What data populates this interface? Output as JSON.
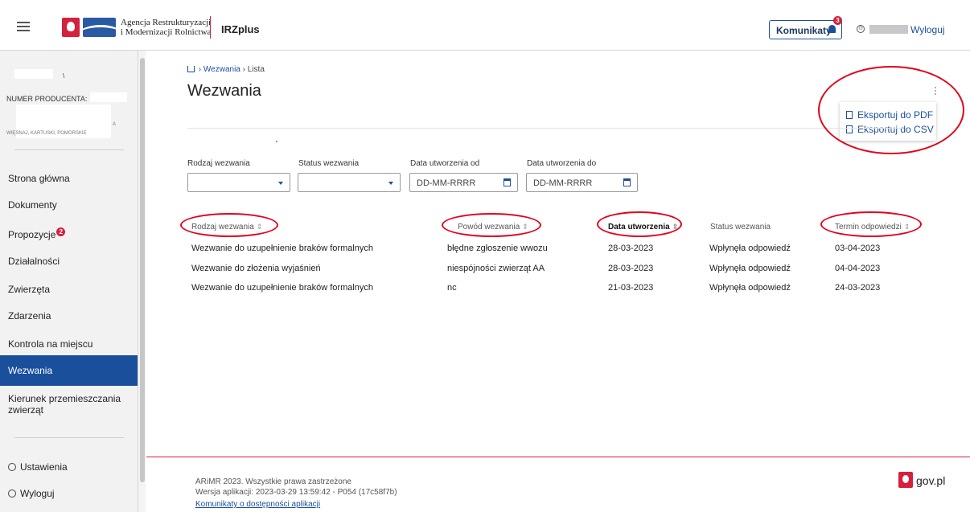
{
  "header": {
    "org_line1": "Agencja Restrukturyzacji",
    "org_line2": "i Modernizacji Rolnictwa",
    "brand": "IRZplus",
    "komunikaty_label": "Komunikaty",
    "notification_count": "3",
    "logout_label": "Wyloguj"
  },
  "sidebar": {
    "producer_label": "NUMER PRODUCENTA:",
    "items": [
      {
        "label": "Strona główna"
      },
      {
        "label": "Dokumenty"
      },
      {
        "label": "Propozycje",
        "badge": "2"
      },
      {
        "label": "Działalności"
      },
      {
        "label": "Zwierzęta"
      },
      {
        "label": "Zdarzenia"
      },
      {
        "label": "Kontrola na miejscu"
      },
      {
        "label": "Wezwania",
        "active": true
      },
      {
        "label": "Kierunek przemieszczania zwierząt"
      }
    ],
    "settings_label": "Ustawienia",
    "logout_label": "Wyloguj"
  },
  "breadcrumb": {
    "section": "Wezwania",
    "current": "Lista"
  },
  "page": {
    "title": "Wezwania"
  },
  "export_menu": {
    "pdf": "Eksportuj do PDF",
    "csv": "Eksportuj do CSV"
  },
  "filters": {
    "type_label": "Rodzaj wezwania",
    "status_label": "Status wezwania",
    "date_from_label": "Data utworzenia od",
    "date_to_label": "Data utworzenia do",
    "date_placeholder": "DD-MM-RRRR"
  },
  "table": {
    "columns": [
      "Rodzaj wezwania",
      "Powód wezwania",
      "Data utworzenia",
      "Status wezwania",
      "Termin odpowiedzi"
    ],
    "rows": [
      [
        "Wezwanie do uzupełnienie braków formalnych",
        "błędne zgłoszenie wwozu",
        "28-03-2023",
        "Wpłynęła odpowiedź",
        "03-04-2023"
      ],
      [
        "Wezwanie do złożenia wyjaśnień",
        "niespójności zwierząt AA",
        "28-03-2023",
        "Wpłynęła odpowiedź",
        "04-04-2023"
      ],
      [
        "Wezwanie do uzupełnienie braków formalnych",
        "nc",
        "21-03-2023",
        "Wpłynęła odpowiedź",
        "24-03-2023"
      ]
    ]
  },
  "footer": {
    "copyright": "ARiMR 2023. Wszystkie prawa zastrzeżone",
    "version": "Wersja aplikacji: 2023-03-29 13:59:42 - P054 (17c58f7b)",
    "accessibility_link": "Komunikaty o dostępności aplikacji",
    "gov": "gov.pl"
  },
  "colors": {
    "primary": "#1a4f9c",
    "accent_red": "#d4213d",
    "annotation": "#e3001b"
  }
}
